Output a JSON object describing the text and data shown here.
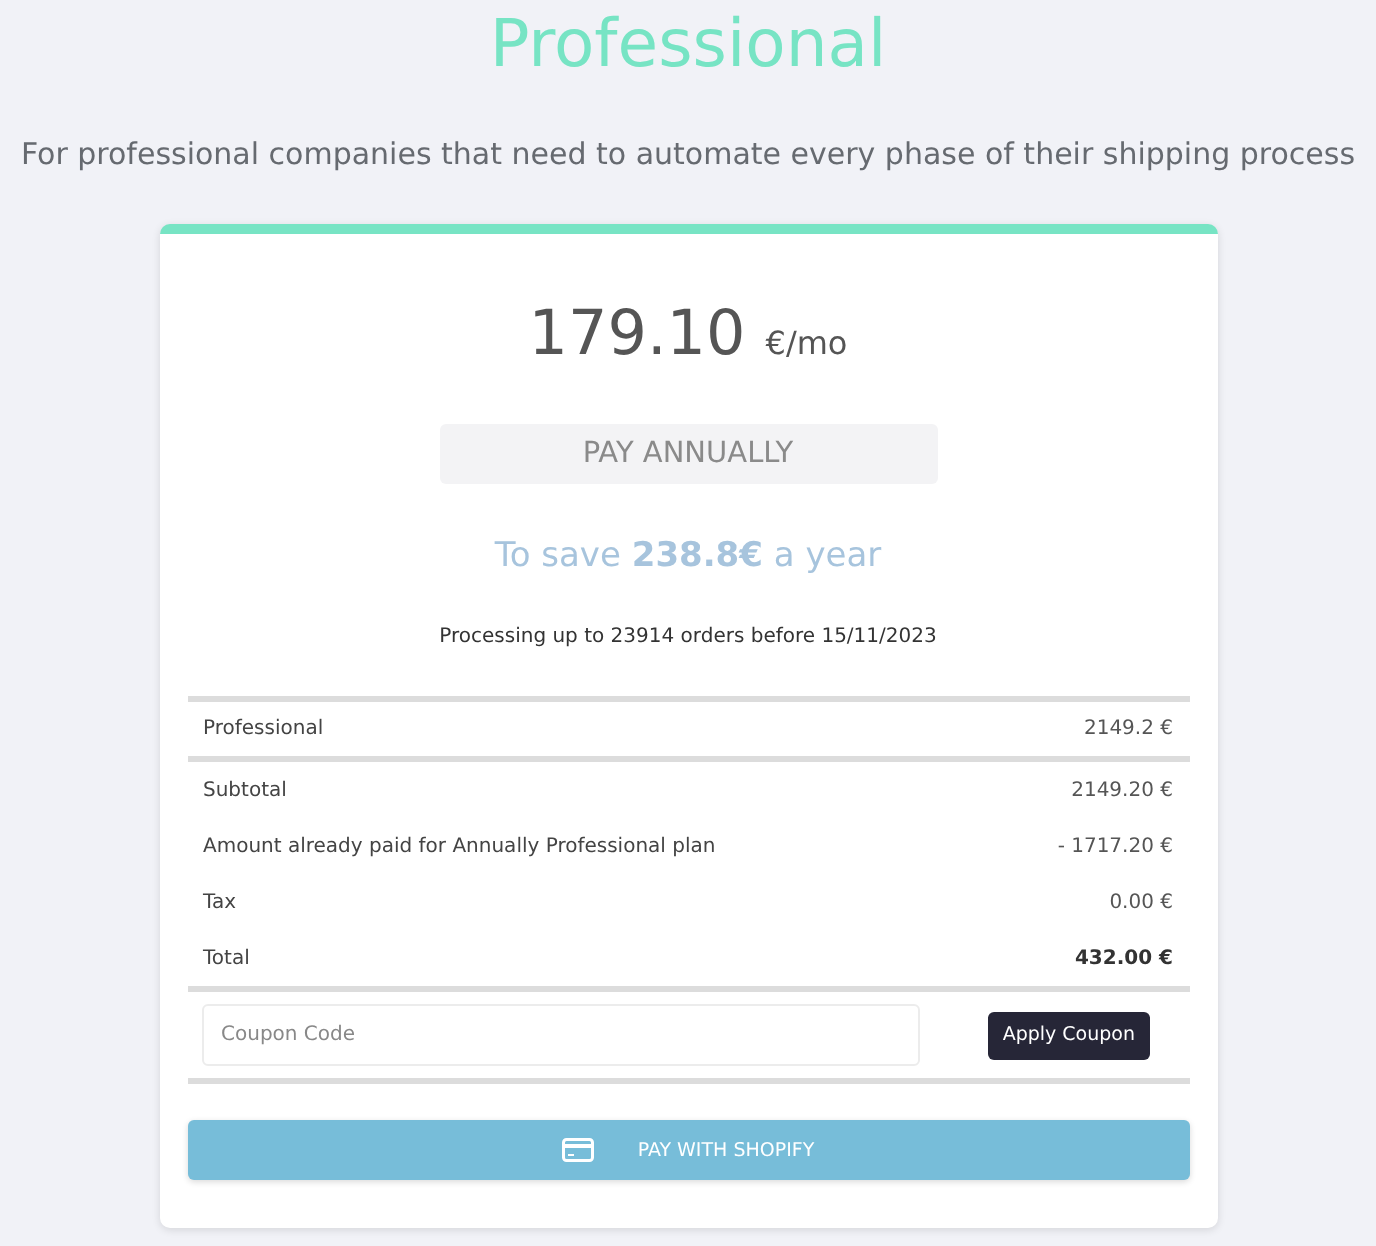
{
  "header": {
    "title": "Professional",
    "subtitle": "For professional companies that need to automate every phase of their shipping process"
  },
  "plan": {
    "price": "179.10",
    "unit": "€/mo",
    "billing_button": "PAY ANNUALLY",
    "savings": "To save **238.8€** a year",
    "limit_note": "Processing up to 23914 orders before 15/11/2023"
  },
  "summary": {
    "items": [
      {
        "label": "Professional",
        "amount": "2149.2 €"
      }
    ],
    "lines": [
      {
        "kind": "normal",
        "label": "Subtotal",
        "amount": "2149.20 €"
      },
      {
        "kind": "normal",
        "label": "Amount already paid for Annually Professional plan",
        "amount": "- 1717.20 €"
      },
      {
        "kind": "normal",
        "label": "Tax",
        "amount": "0.00 €"
      },
      {
        "kind": "total",
        "label": "Total",
        "amount": "432.00 €"
      }
    ]
  },
  "coupon": {
    "placeholder": "Coupon Code",
    "button": "Apply Coupon"
  },
  "pay_button": {
    "label": "PAY WITH SHOPIFY"
  }
}
